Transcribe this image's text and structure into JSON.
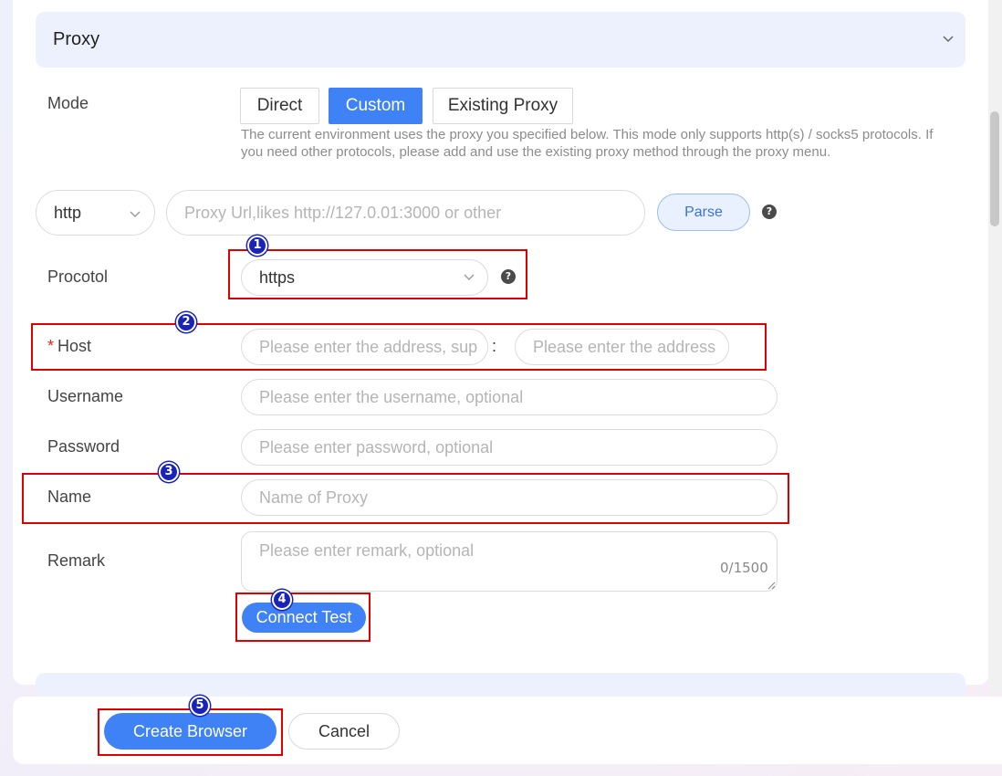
{
  "section": {
    "title": "Proxy",
    "icon": "chevron-down-icon"
  },
  "mode": {
    "label": "Mode",
    "options": [
      "Direct",
      "Custom",
      "Existing Proxy"
    ],
    "selected": "Custom",
    "hint": "The current environment uses the proxy you specified below. This mode only supports http(s) / socks5 protocols. If you need other protocols, please add and use the existing proxy method through the proxy menu."
  },
  "proxy_url": {
    "scheme": "http",
    "placeholder": "Proxy Url,likes http://127.0.01:3000 or other",
    "parse_label": "Parse"
  },
  "protocol": {
    "label": "Procotol",
    "value": "https"
  },
  "host": {
    "required_mark": "*",
    "label": "Host",
    "address_placeholder": "Please enter the address, sup",
    "separator": ":",
    "port_placeholder": "Please enter the address"
  },
  "username": {
    "label": "Username",
    "placeholder": "Please enter the username, optional"
  },
  "password": {
    "label": "Password",
    "placeholder": "Please enter password, optional"
  },
  "name": {
    "label": "Name",
    "placeholder": "Name of Proxy"
  },
  "remark": {
    "label": "Remark",
    "placeholder": "Please enter remark, optional",
    "counter": "0/1500"
  },
  "connect_test_label": "Connect Test",
  "footer": {
    "create_label": "Create Browser",
    "cancel_label": "Cancel"
  },
  "annotations": [
    "1",
    "2",
    "3",
    "4",
    "5"
  ],
  "colors": {
    "accent": "#3f82f6",
    "highlight": "#e00000",
    "marker": "#1a23b8"
  },
  "help_glyph": "?"
}
